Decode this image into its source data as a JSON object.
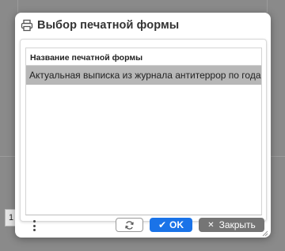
{
  "dialog": {
    "title": "Выбор печатной формы",
    "table": {
      "header": "Название печатной формы",
      "rows": [
        "Актуальная выписка из журнала антитеррор по годам"
      ]
    },
    "buttons": {
      "ok_label": "OK",
      "close_label": "Закрыть"
    }
  },
  "background": {
    "tab_label": "1"
  },
  "colors": {
    "primary": "#1a73e8",
    "secondary": "#757575",
    "selected_row": "#b7b7b7"
  },
  "icons": {
    "header": "printer-icon",
    "refresh": "refresh-icon",
    "ok": "check-icon",
    "close": "close-icon",
    "more": "kebab-menu-icon"
  }
}
